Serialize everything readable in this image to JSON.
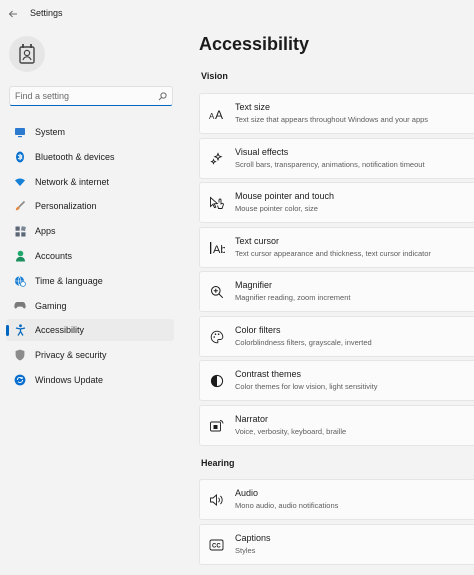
{
  "window": {
    "title": "Settings"
  },
  "search": {
    "placeholder": "Find a setting",
    "value": ""
  },
  "sidebar": {
    "items": [
      {
        "label": "System",
        "icon": "monitor-icon",
        "color": "#0067c0"
      },
      {
        "label": "Bluetooth & devices",
        "icon": "bluetooth-icon",
        "color": "#0078d4"
      },
      {
        "label": "Network & internet",
        "icon": "wifi-icon",
        "color": "#0e7ad1"
      },
      {
        "label": "Personalization",
        "icon": "brush-icon",
        "color": "#e07b39"
      },
      {
        "label": "Apps",
        "icon": "apps-icon",
        "color": "#5c6b7a"
      },
      {
        "label": "Accounts",
        "icon": "person-icon",
        "color": "#1ba36b"
      },
      {
        "label": "Time & language",
        "icon": "globe-clock-icon",
        "color": "#0e7ad1"
      },
      {
        "label": "Gaming",
        "icon": "gamepad-icon",
        "color": "#6b6b6b"
      },
      {
        "label": "Accessibility",
        "icon": "accessibility-icon",
        "color": "#0067c0",
        "active": true
      },
      {
        "label": "Privacy & security",
        "icon": "shield-icon",
        "color": "#7a7a7a"
      },
      {
        "label": "Windows Update",
        "icon": "update-icon",
        "color": "#0067c0"
      }
    ]
  },
  "main": {
    "title": "Accessibility",
    "sections": [
      {
        "label": "Vision",
        "items": [
          {
            "title": "Text size",
            "desc": "Text size that appears throughout Windows and your apps",
            "icon": "text-size-icon"
          },
          {
            "title": "Visual effects",
            "desc": "Scroll bars, transparency, animations, notification timeout",
            "icon": "sparkle-icon"
          },
          {
            "title": "Mouse pointer and touch",
            "desc": "Mouse pointer color, size",
            "icon": "pointer-icon"
          },
          {
            "title": "Text cursor",
            "desc": "Text cursor appearance and thickness, text cursor indicator",
            "icon": "text-cursor-icon"
          },
          {
            "title": "Magnifier",
            "desc": "Magnifier reading, zoom increment",
            "icon": "magnifier-icon"
          },
          {
            "title": "Color filters",
            "desc": "Colorblindness filters, grayscale, inverted",
            "icon": "palette-icon"
          },
          {
            "title": "Contrast themes",
            "desc": "Color themes for low vision, light sensitivity",
            "icon": "contrast-icon"
          },
          {
            "title": "Narrator",
            "desc": "Voice, verbosity, keyboard, braille",
            "icon": "narrator-icon"
          }
        ]
      },
      {
        "label": "Hearing",
        "items": [
          {
            "title": "Audio",
            "desc": "Mono audio, audio notifications",
            "icon": "speaker-icon"
          },
          {
            "title": "Captions",
            "desc": "Styles",
            "icon": "captions-icon"
          }
        ]
      }
    ]
  }
}
